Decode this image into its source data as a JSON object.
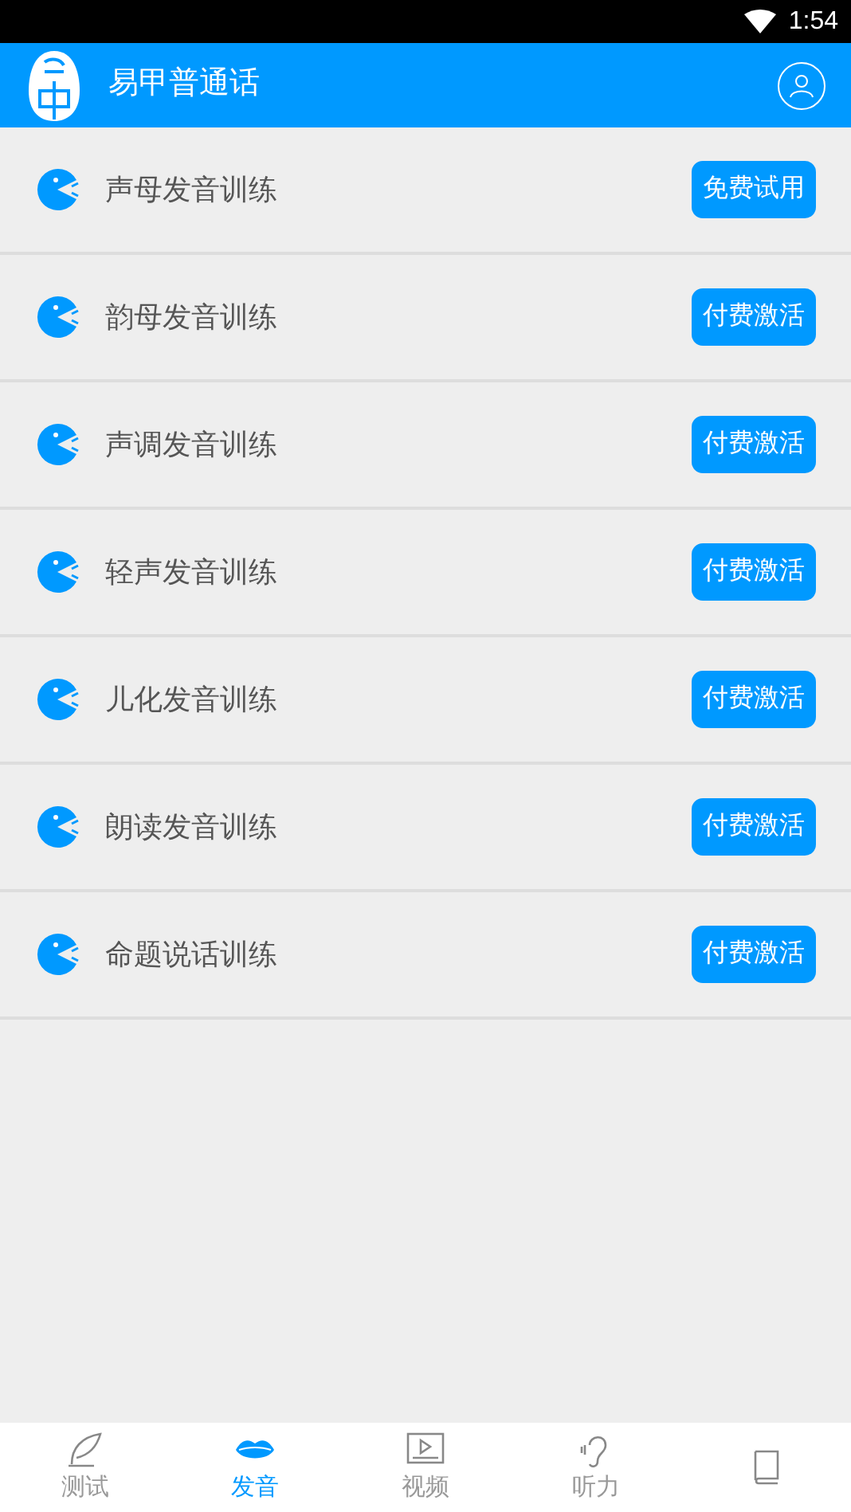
{
  "status_bar": {
    "time": "1:54"
  },
  "header": {
    "title": "易甲普通话"
  },
  "items": [
    {
      "label": "声母发音训练",
      "action": "免费试用"
    },
    {
      "label": "韵母发音训练",
      "action": "付费激活"
    },
    {
      "label": "声调发音训练",
      "action": "付费激活"
    },
    {
      "label": "轻声发音训练",
      "action": "付费激活"
    },
    {
      "label": "儿化发音训练",
      "action": "付费激活"
    },
    {
      "label": "朗读发音训练",
      "action": "付费激活"
    },
    {
      "label": "命题说话训练",
      "action": "付费激活"
    }
  ],
  "bottom_nav": [
    {
      "kind": "test",
      "label": "测试",
      "selected": false
    },
    {
      "kind": "pronounce",
      "label": "发音",
      "selected": true
    },
    {
      "kind": "video",
      "label": "视频",
      "selected": false
    },
    {
      "kind": "listen",
      "label": "听力",
      "selected": false
    },
    {
      "kind": "book",
      "selected": false
    }
  ]
}
